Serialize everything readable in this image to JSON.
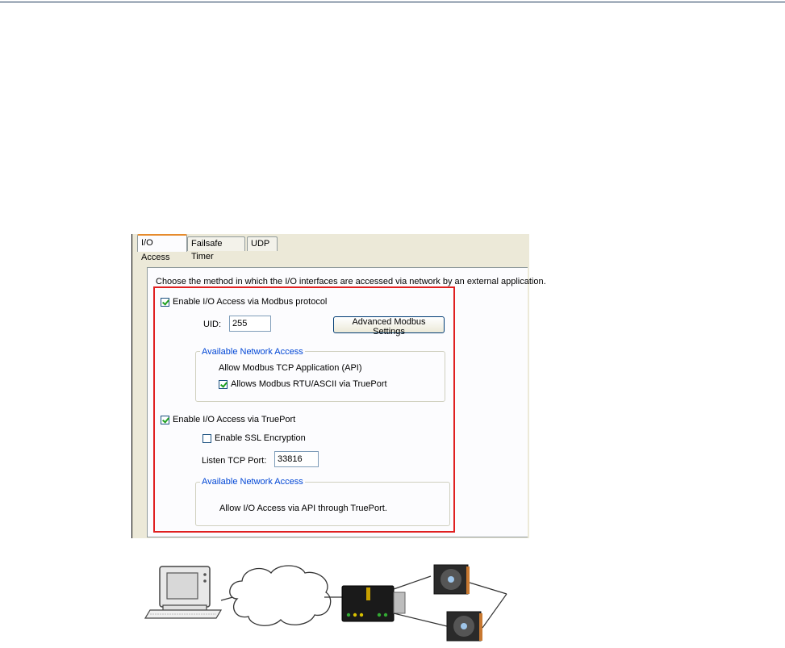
{
  "tabs": [
    {
      "label": "I/O Access",
      "active": true
    },
    {
      "label": "Failsafe Timer",
      "active": false
    },
    {
      "label": "UDP",
      "active": false
    }
  ],
  "description": "Choose the method in which the I/O interfaces are accessed via network by an external application.",
  "modbus": {
    "enable_label": "Enable I/O Access via Modbus protocol",
    "enabled": true,
    "uid_label": "UID:",
    "uid_value": "255",
    "advanced_button": "Advanced Modbus Settings",
    "network_group": {
      "title": "Available Network Access",
      "api_text": "Allow Modbus TCP Application (API)",
      "rtu_label": "Allows Modbus RTU/ASCII via TruePort",
      "rtu_checked": true
    }
  },
  "trueport": {
    "enable_label": "Enable I/O Access via TruePort",
    "enabled": true,
    "ssl_label": "Enable SSL Encryption",
    "ssl_checked": false,
    "port_label": "Listen TCP Port:",
    "port_value": "33816",
    "network_group": {
      "title": "Available Network Access",
      "text": "Allow I/O Access via API through TruePort."
    }
  },
  "colors": {
    "highlight_border": "#e02020",
    "group_title": "#0046d5",
    "check": "#21a121"
  }
}
